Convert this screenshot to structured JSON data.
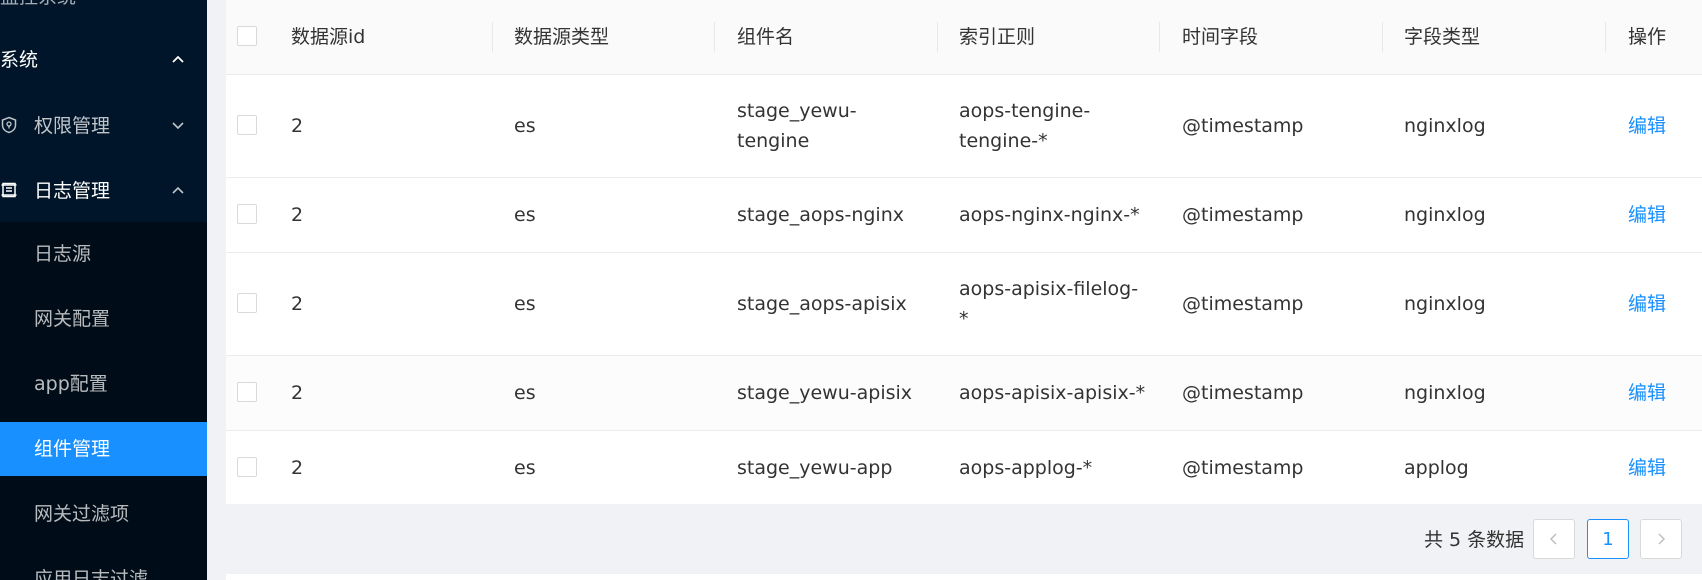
{
  "sidebar": {
    "cut_label": "监控系统",
    "system_label": "系统",
    "permission_label": "权限管理",
    "logs_label": "日志管理",
    "sub_items": [
      {
        "label": "日志源"
      },
      {
        "label": "网关配置"
      },
      {
        "label": "app配置"
      },
      {
        "label": "组件管理",
        "active": true
      },
      {
        "label": "网关过滤项"
      },
      {
        "label": "应用日志过滤"
      }
    ]
  },
  "table": {
    "columns": [
      "数据源id",
      "数据源类型",
      "组件名",
      "索引正则",
      "时间字段",
      "字段类型",
      "操作"
    ],
    "rows": [
      {
        "id": "2",
        "type": "es",
        "component": [
          "stage_yewu-",
          "tengine"
        ],
        "index": [
          "aops-tengine-",
          "tengine-*"
        ],
        "time_field": "@timestamp",
        "field_type": "nginxlog",
        "action": "编辑"
      },
      {
        "id": "2",
        "type": "es",
        "component": [
          "stage_aops-nginx"
        ],
        "index": [
          "aops-nginx-nginx-*"
        ],
        "time_field": "@timestamp",
        "field_type": "nginxlog",
        "action": "编辑"
      },
      {
        "id": "2",
        "type": "es",
        "component": [
          "stage_aops-apisix"
        ],
        "index": [
          "aops-apisix-filelog-",
          "*"
        ],
        "time_field": "@timestamp",
        "field_type": "nginxlog",
        "action": "编辑"
      },
      {
        "id": "2",
        "type": "es",
        "component": [
          "stage_yewu-apisix"
        ],
        "index": [
          "aops-apisix-apisix-*"
        ],
        "time_field": "@timestamp",
        "field_type": "nginxlog",
        "action": "编辑"
      },
      {
        "id": "2",
        "type": "es",
        "component": [
          "stage_yewu-app"
        ],
        "index": [
          "aops-applog-*"
        ],
        "time_field": "@timestamp",
        "field_type": "applog",
        "action": "编辑"
      }
    ]
  },
  "pagination": {
    "total_text": "共 5 条数据",
    "current_page": "1"
  },
  "colors": {
    "sidebar_bg": "#001529",
    "submenu_bg": "#000c17",
    "accent": "#1890ff"
  }
}
